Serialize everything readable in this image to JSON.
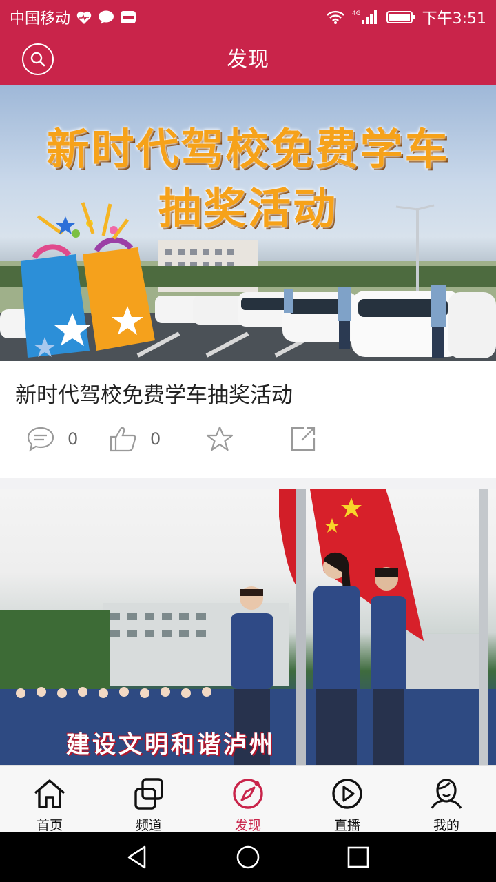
{
  "status_bar": {
    "carrier": "中国移动",
    "time": "下午3:51",
    "network": "4G",
    "icons": [
      "heart-pulse-icon",
      "chat-bubble-icon",
      "news-app-icon",
      "wifi-icon",
      "signal-icon",
      "battery-icon"
    ]
  },
  "app_bar": {
    "title": "发现",
    "search_icon": "search-icon"
  },
  "feed": {
    "items": [
      {
        "image_text_line1": "新时代驾校免费学车",
        "image_text_line2": "抽奖活动",
        "title": "新时代驾校免费学车抽奖活动",
        "comments": "0",
        "likes": "0"
      },
      {
        "image_caption": "建设文明和谐泸州"
      }
    ]
  },
  "bottom_nav": {
    "tabs": [
      {
        "label": "首页",
        "icon": "home-icon"
      },
      {
        "label": "频道",
        "icon": "channels-icon"
      },
      {
        "label": "发现",
        "icon": "compass-icon",
        "active": true
      },
      {
        "label": "直播",
        "icon": "play-circle-icon"
      },
      {
        "label": "我的",
        "icon": "profile-icon"
      }
    ]
  },
  "colors": {
    "brand": "#c9244a",
    "icon_gray": "#9a9a9a",
    "nav_text": "#111111"
  }
}
